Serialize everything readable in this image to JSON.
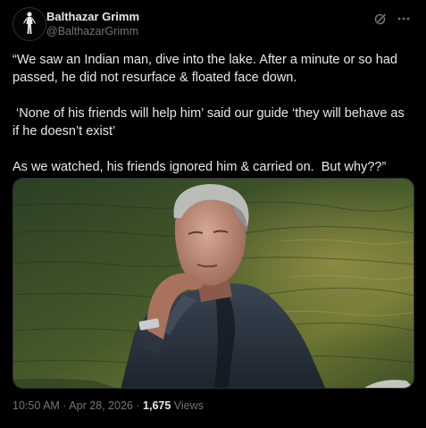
{
  "author": {
    "display_name": "Balthazar Grimm",
    "handle": "@BalthazarGrimm",
    "avatar_icon": "silhouette-figure-icon"
  },
  "actions": {
    "grok_icon": "grok-icon",
    "more_icon": "more-horizontal-icon"
  },
  "tweet": {
    "paragraphs": [
      "“We saw an Indian man, dive into the lake. After a minute or so had passed, he did not resurface & floated face down.",
      " ‘None of his friends will help him’ said our guide ‘they will behave as if he doesn’t exist’",
      "As we watched, his friends ignored him & carried on.  But why??”"
    ]
  },
  "media": {
    "subject": "photo of older man in dark jacket, chin resting on hand, in front of green lake water"
  },
  "meta": {
    "time": "10:50 AM",
    "separator": "·",
    "date": "Apr 28, 2026",
    "views_count": "1,675",
    "views_label": "Views"
  },
  "colors": {
    "background": "#000000",
    "text_primary": "#e7e9ea",
    "text_secondary": "#71767b",
    "border": "#2f3336"
  }
}
